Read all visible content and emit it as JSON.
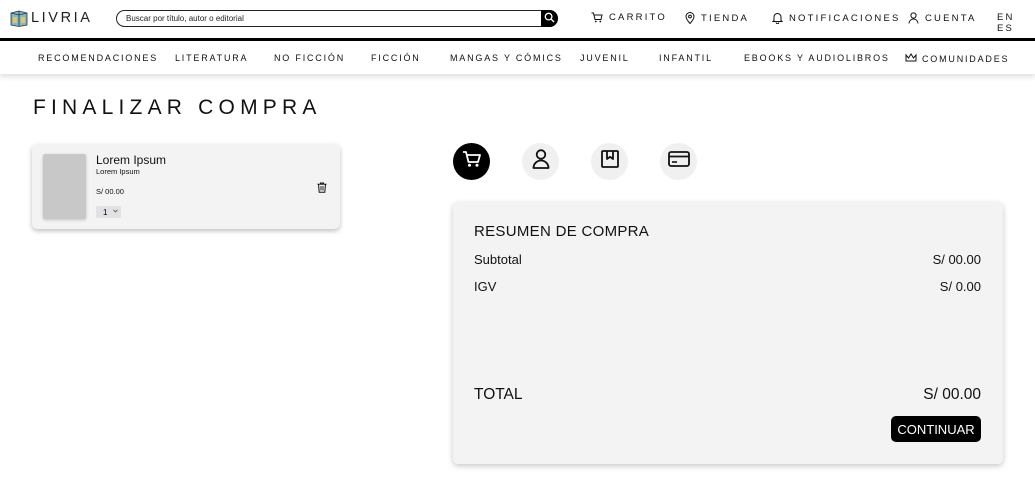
{
  "header": {
    "logo_text": "LIVRIA",
    "search_placeholder": "Buscar por título, autor o editorial",
    "nav": {
      "cart": "CARRITO",
      "store": "TIENDA",
      "notifications": "NOTIFICACIONES",
      "account": "CUENTA",
      "language": "EN ES"
    }
  },
  "categories": [
    "RECOMENDACIONES",
    "LITERATURA",
    "NO FICCIÓN",
    "FICCIÓN",
    "MANGAS Y CÓMICS",
    "JUVENIL",
    "INFANTIL",
    "EBOOKS Y AUDIOLIBROS",
    "COMUNIDADES"
  ],
  "page_title": "FINALIZAR COMPRA",
  "cart_item": {
    "title": "Lorem Ipsum",
    "author": "Lorem Ipsum",
    "price": "S/ 00.00",
    "quantity": "1"
  },
  "steps": [
    {
      "icon": "cart-icon",
      "active": true
    },
    {
      "icon": "user-icon",
      "active": false
    },
    {
      "icon": "bookmark-icon",
      "active": false
    },
    {
      "icon": "credit-card-icon",
      "active": false
    }
  ],
  "summary": {
    "title": "RESUMEN DE COMPRA",
    "subtotal_label": "Subtotal",
    "subtotal_value": "S/ 00.00",
    "igv_label": "IGV",
    "igv_value": "S/ 0.00",
    "total_label": "TOTAL",
    "total_value": "S/ 00.00",
    "continue_label": "CONTINUAR"
  },
  "colors": {
    "accent": "#000000",
    "card_bg": "#f3f3f4",
    "thumb": "#c8c8c8"
  }
}
